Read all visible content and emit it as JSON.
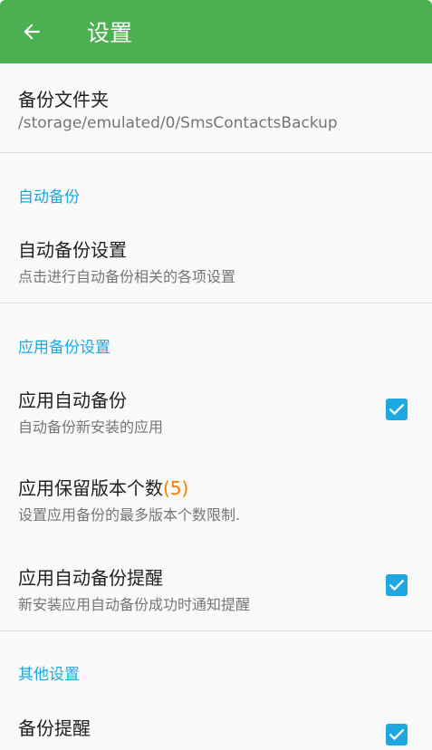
{
  "appbar": {
    "title": "设置",
    "back_icon": "arrow-left-icon",
    "color": "#4caf50"
  },
  "backup_folder": {
    "title": "备份文件夹",
    "summary": "/storage/emulated/0/SmsContactsBackup"
  },
  "auto_backup": {
    "category": "自动备份",
    "settings_title": "自动备份设置",
    "settings_summary": "点击进行自动备份相关的各项设置"
  },
  "app_backup": {
    "category": "应用备份设置",
    "auto_title": "应用自动备份",
    "auto_summary": "自动备份新安装的应用",
    "auto_checked": true,
    "keep_title": "应用保留版本个数",
    "keep_count": "(5)",
    "keep_summary": "设置应用备份的最多版本个数限制.",
    "remind_title": "应用自动备份提醒",
    "remind_summary": "新安装应用自动备份成功时通知提醒",
    "remind_checked": true
  },
  "other": {
    "category": "其他设置",
    "backup_remind_title": "备份提醒",
    "backup_remind_checked": true
  },
  "colors": {
    "accent": "#1ea7e0",
    "count_highlight": "#f57c00"
  }
}
